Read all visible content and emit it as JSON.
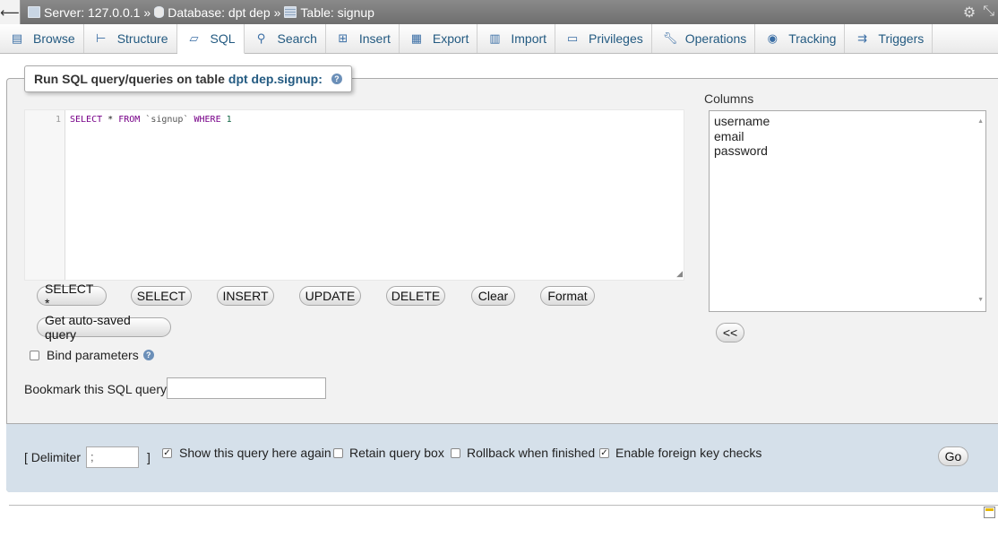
{
  "breadcrumb": {
    "server": "Server: 127.0.0.1",
    "database": "Database: dpt dep",
    "table": "Table: signup",
    "separator": "»"
  },
  "tabs": [
    {
      "label": "Browse",
      "icon": "browse-icon"
    },
    {
      "label": "Structure",
      "icon": "structure-icon"
    },
    {
      "label": "SQL",
      "icon": "sql-icon",
      "active": true
    },
    {
      "label": "Search",
      "icon": "search-icon"
    },
    {
      "label": "Insert",
      "icon": "insert-icon"
    },
    {
      "label": "Export",
      "icon": "export-icon"
    },
    {
      "label": "Import",
      "icon": "import-icon"
    },
    {
      "label": "Privileges",
      "icon": "privileges-icon"
    },
    {
      "label": "Operations",
      "icon": "wrench-icon"
    },
    {
      "label": "Tracking",
      "icon": "eye-icon"
    },
    {
      "label": "Triggers",
      "icon": "triggers-icon"
    }
  ],
  "legend": {
    "text": "Run SQL query/queries on table",
    "link": "dpt dep.signup:"
  },
  "editor": {
    "line_number": "1",
    "query": {
      "kw1": "SELECT",
      "star": " * ",
      "kw2": "FROM",
      "table": " `signup` ",
      "kw3": "WHERE",
      "num": " 1"
    }
  },
  "buttons": {
    "select_star": "SELECT *",
    "select": "SELECT",
    "insert": "INSERT",
    "update": "UPDATE",
    "delete": "DELETE",
    "clear": "Clear",
    "format": "Format",
    "autosaved": "Get auto-saved query",
    "insert_column": "<<",
    "go": "Go"
  },
  "bind_parameters": {
    "label": "Bind parameters",
    "checked": false
  },
  "bookmark": {
    "label": "Bookmark this SQL query:",
    "value": ""
  },
  "columns": {
    "label": "Columns",
    "items": [
      "username",
      "email",
      "password"
    ]
  },
  "options": {
    "delimiter_open": "[ Delimiter",
    "delimiter_value": ";",
    "delimiter_close": "]",
    "show_query": {
      "label": "Show this query here again",
      "checked": true
    },
    "retain_box": {
      "label": "Retain query box",
      "checked": false
    },
    "rollback": {
      "label": "Rollback when finished",
      "checked": false
    },
    "foreign_keys": {
      "label": "Enable foreign key checks",
      "checked": true
    }
  },
  "colors": {
    "link": "#235a81",
    "options_bg": "#d5e0ea",
    "panel_bg": "#f2f2f2"
  }
}
